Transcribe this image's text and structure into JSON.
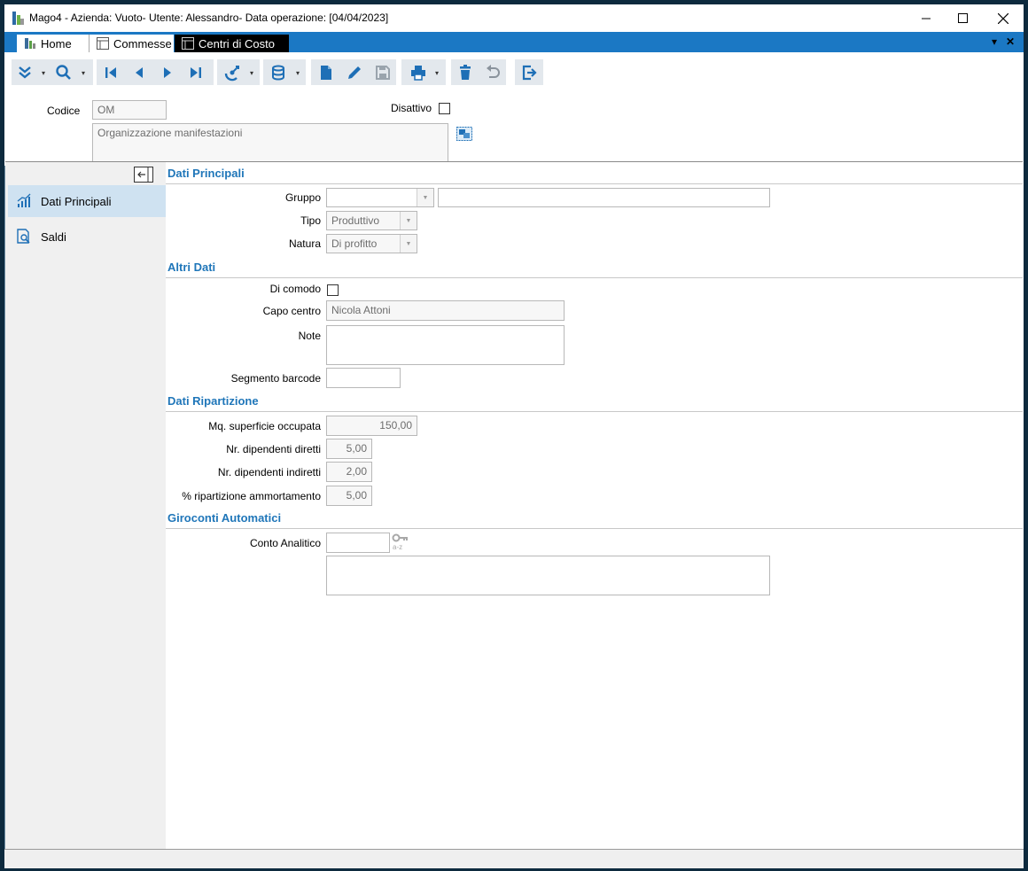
{
  "window": {
    "title": "Mago4 - Azienda: Vuoto- Utente: Alessandro- Data operazione: [04/04/2023]",
    "min_icon": "minimize-icon",
    "max_icon": "maximize-icon",
    "close_icon": "close-icon"
  },
  "tabs": [
    {
      "label": "Home",
      "icon": "home-icon"
    },
    {
      "label": "Commesse",
      "icon": "form-icon"
    },
    {
      "label": "Centri di Costo",
      "icon": "form-icon"
    }
  ],
  "toolbar": {
    "icons": [
      "expand-icon",
      "search-icon",
      "first-record-icon",
      "previous-record-icon",
      "next-record-icon",
      "last-record-icon",
      "radar-icon",
      "database-icon",
      "new-document-icon",
      "edit-icon",
      "save-icon",
      "print-icon",
      "delete-icon",
      "undo-icon",
      "exit-icon"
    ]
  },
  "header": {
    "codice_label": "Codice",
    "codice_value": "OM",
    "descrizione_value": "Organizzazione manifestazioni",
    "disattivo_label": "Disattivo"
  },
  "sidebar": {
    "items": [
      {
        "label": "Dati Principali",
        "icon": "chart-icon"
      },
      {
        "label": "Saldi",
        "icon": "document-search-icon"
      }
    ]
  },
  "sections": {
    "dati_principali": "Dati Principali",
    "altri_dati": "Altri Dati",
    "dati_ripartizione": "Dati Ripartizione",
    "giroconti": "Giroconti Automatici"
  },
  "fields": {
    "gruppo_label": "Gruppo",
    "gruppo_value": "",
    "gruppo_desc": "",
    "tipo_label": "Tipo",
    "tipo_value": "Produttivo",
    "natura_label": "Natura",
    "natura_value": "Di profitto",
    "di_comodo_label": "Di comodo",
    "capo_centro_label": "Capo centro",
    "capo_centro_value": "Nicola Attoni",
    "note_label": "Note",
    "note_value": "",
    "segmento_label": "Segmento barcode",
    "segmento_value": "",
    "mq_label": "Mq. superficie occupata",
    "mq_value": "150,00",
    "dip_diretti_label": "Nr. dipendenti diretti",
    "dip_diretti_value": "5,00",
    "dip_indiretti_label": "Nr. dipendenti indiretti",
    "dip_indiretti_value": "2,00",
    "ammortamento_label": "% ripartizione ammortamento",
    "ammortamento_value": "5,00",
    "conto_label": "Conto Analitico",
    "conto_value": "",
    "conto_desc": ""
  }
}
